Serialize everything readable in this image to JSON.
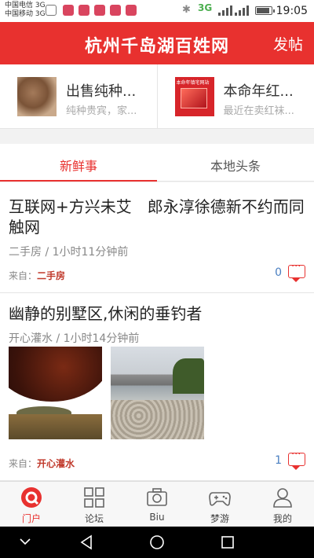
{
  "status_bar": {
    "carrier1": "中国电信 3G",
    "carrier2": "中国移动 3G",
    "net_label": "3G",
    "time": "19:05"
  },
  "header": {
    "title": "杭州千岛湖百姓网",
    "post_button": "发帖"
  },
  "promos": [
    {
      "title": "出售纯种...",
      "subtitle": "纯种贵宾，家...",
      "thumb_label": ""
    },
    {
      "title": "本命年红...",
      "subtitle": "最近在卖红袜...",
      "thumb_label": "本命年镇宅网站"
    }
  ],
  "tabs": [
    {
      "label": "新鲜事",
      "active": true
    },
    {
      "label": "本地头条",
      "active": false
    }
  ],
  "feed": [
    {
      "title": "互联网+方兴未艾　郎永淳徐德新不约而同触网",
      "meta": "二手房 / 1小时11分钟前",
      "source_prefix": "来自：",
      "source": "二手房",
      "comments": "0"
    },
    {
      "title": "幽静的别墅区,休闲的垂钓者",
      "meta": "开心灌水 / 1小时14分钟前",
      "source_prefix": "来自：",
      "source": "开心灌水",
      "comments": "1"
    }
  ],
  "bottom_nav": [
    {
      "label": "门户",
      "icon": "portal-icon",
      "active": true
    },
    {
      "label": "论坛",
      "icon": "grid-icon",
      "active": false
    },
    {
      "label": "Biu",
      "icon": "camera-icon",
      "active": false
    },
    {
      "label": "梦游",
      "icon": "gamepad-icon",
      "active": false
    },
    {
      "label": "我的",
      "icon": "user-icon",
      "active": false
    }
  ],
  "colors": {
    "accent": "#e8312f",
    "link_blue": "#4a7fc1"
  }
}
